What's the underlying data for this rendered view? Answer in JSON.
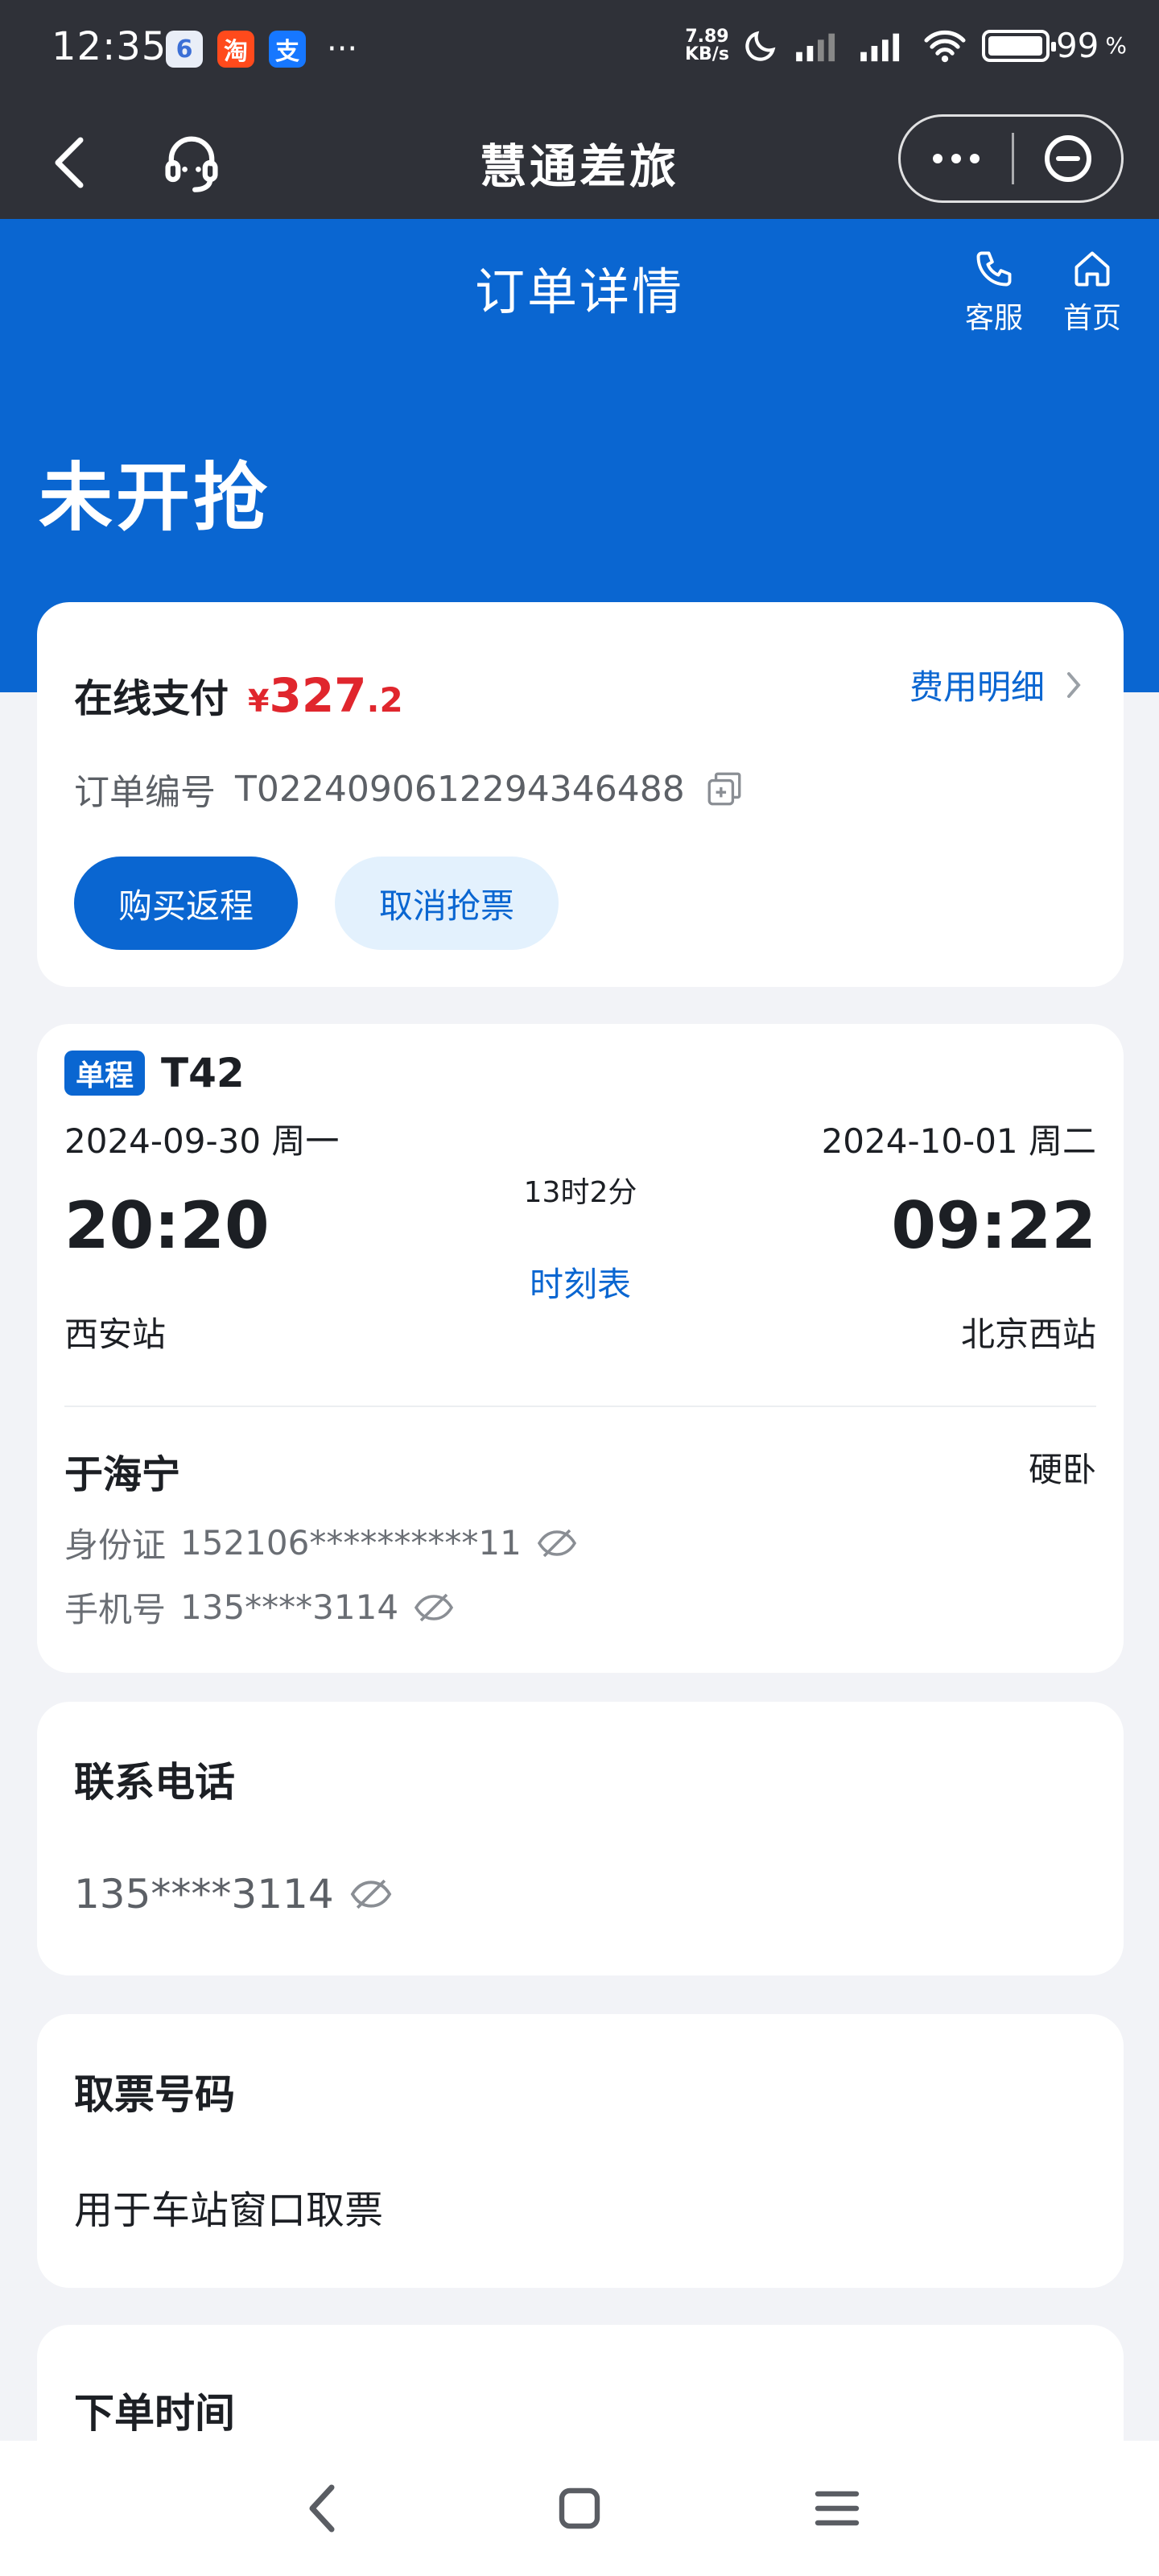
{
  "status_bar": {
    "time": "12:35",
    "app_icons": [
      {
        "name": "app-icon-6",
        "glyph": "6"
      },
      {
        "name": "taobao-icon",
        "glyph": "淘"
      },
      {
        "name": "alipay-icon",
        "glyph": "支"
      }
    ],
    "more": "···",
    "net_speed": "7.89",
    "net_unit": "KB/s",
    "battery": "99",
    "battery_unit": "%"
  },
  "nav": {
    "title": "慧通差旅"
  },
  "header": {
    "title": "订单详情",
    "service_label": "客服",
    "home_label": "首页",
    "status": "未开抢"
  },
  "payment": {
    "label": "在线支付",
    "currency": "¥",
    "amount_int": "327",
    "amount_dec": ".2",
    "fee_detail": "费用明细",
    "order_no_label": "订单编号",
    "order_no": "T022409061229434648​8",
    "buy_return": "购买返程",
    "cancel_grab": "取消抢票"
  },
  "trip": {
    "tag": "单程",
    "train_no": "T42",
    "depart_date": "2024-09-30 周一",
    "arrive_date": "2024-10-01 周二",
    "depart_time": "20:20",
    "arrive_time": "09:22",
    "duration": "13时2分",
    "timetable": "时刻表",
    "depart_station": "西安站",
    "arrive_station": "北京西站"
  },
  "passenger": {
    "name": "于海宁",
    "seat": "硬卧",
    "id_label": "身份证",
    "id_value": "152106**********11",
    "phone_label": "手机号",
    "phone_value": "135****3114"
  },
  "contact": {
    "title": "联系电话",
    "phone": "135****3114"
  },
  "ticket": {
    "title": "取票号码",
    "desc": "用于车站窗口取票"
  },
  "order_time": {
    "title": "下单时间"
  },
  "colors": {
    "primary": "#0a66d1",
    "price": "#e0262d",
    "dark_bar": "#2f3138"
  }
}
